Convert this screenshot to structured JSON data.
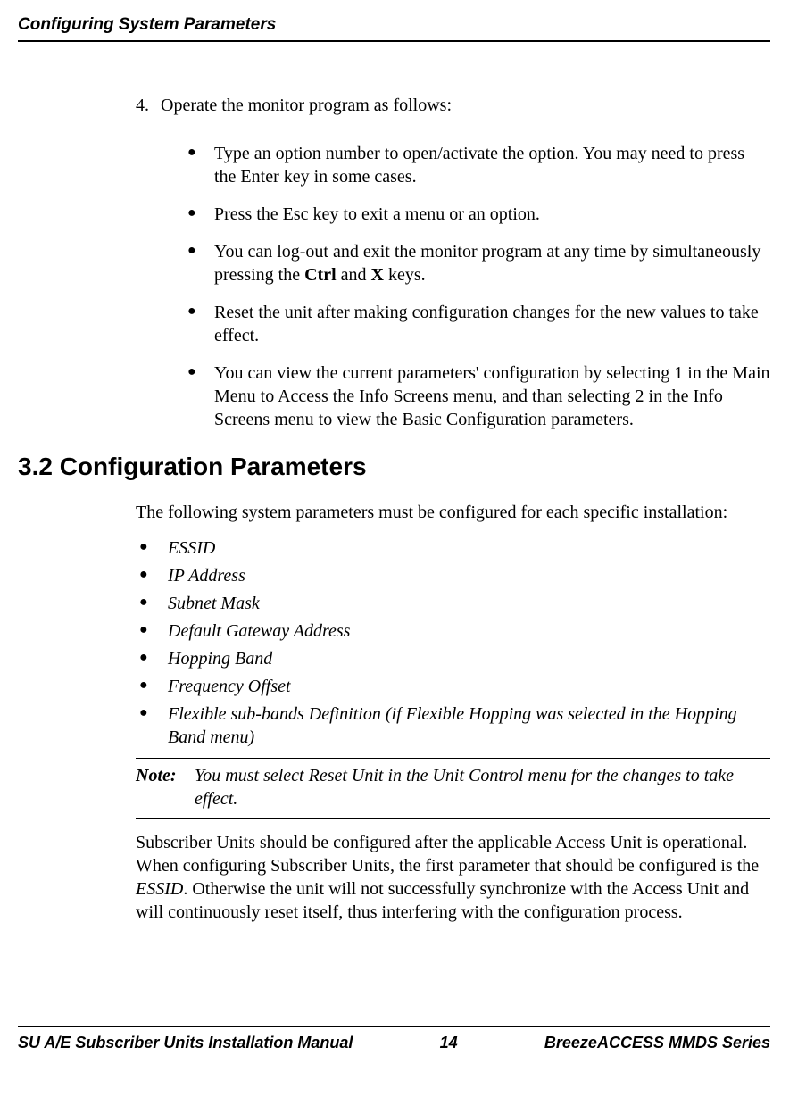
{
  "header": {
    "title": "Configuring System Parameters"
  },
  "main": {
    "step_number": "4.",
    "step_text": "Operate the monitor program as follows:",
    "bullets": [
      {
        "text": "Type an option number to open/activate the option. You may need to press the Enter key in some cases."
      },
      {
        "text": "Press the Esc key to exit a menu or an option."
      },
      {
        "pre": "You can log-out and exit the monitor program at any time by simultaneously pressing the ",
        "b1": "Ctrl",
        "mid": " and ",
        "b2": "X",
        "post": " keys."
      },
      {
        "text": "Reset the unit after making configuration changes for the new values to take effect."
      },
      {
        "text": "You can view the current parameters' configuration by selecting 1 in the Main Menu to Access the Info Screens menu, and than selecting 2 in the Info Screens menu to view the Basic Configuration parameters."
      }
    ],
    "section_heading": "3.2  Configuration Parameters",
    "section_intro": "The following system parameters must be configured for each specific installation:",
    "params": [
      "ESSID",
      "IP Address",
      "Subnet Mask",
      "Default Gateway Address",
      "Hopping Band",
      "Frequency Offset",
      "Flexible sub-bands Definition (if Flexible Hopping was selected in the Hopping Band menu)"
    ],
    "note_label": "Note:",
    "note_text": "You must select Reset Unit in the Unit Control menu for the changes to take effect.",
    "para_pre": "Subscriber Units should be configured after the applicable Access Unit is operational. When configuring Subscriber Units, the first parameter that should be configured is the ",
    "para_i": "ESSID",
    "para_post": ". Otherwise the unit will not successfully synchronize with the Access Unit and will continuously reset itself, thus interfering with the configuration process."
  },
  "footer": {
    "left": "SU A/E Subscriber Units Installation Manual",
    "center": "14",
    "right": "BreezeACCESS MMDS Series"
  }
}
